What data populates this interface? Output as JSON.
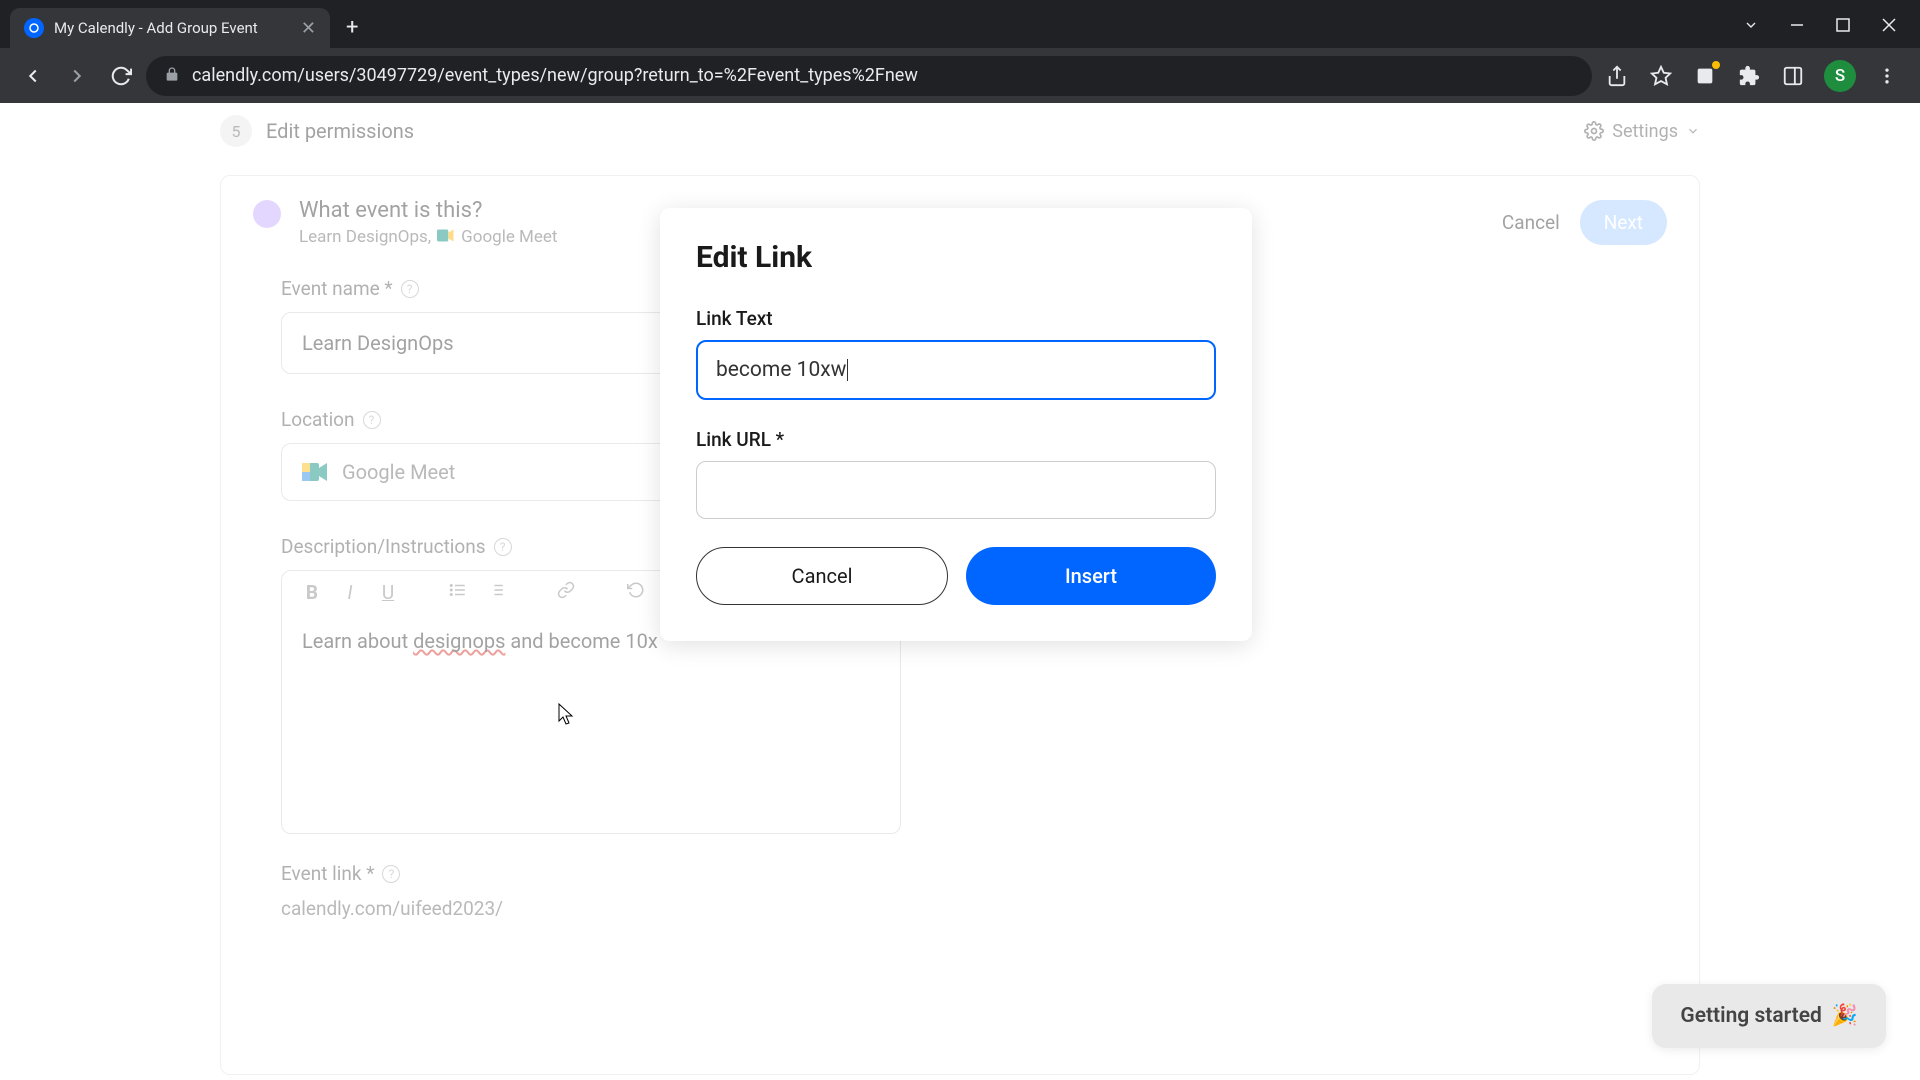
{
  "browser": {
    "tab_title": "My Calendly - Add Group Event",
    "url": "calendly.com/users/30497729/event_types/new/group?return_to=%2Fevent_types%2Fnew",
    "avatar_initial": "S"
  },
  "page_header": {
    "step_num": "5",
    "step_label": "Edit permissions",
    "settings": "Settings"
  },
  "card": {
    "heading": "What event is this?",
    "sub_pre": "Learn DesignOps,",
    "sub_post": "Google Meet",
    "cancel": "Cancel",
    "next": "Next"
  },
  "form": {
    "event_name_label": "Event name *",
    "event_name_value": "Learn DesignOps",
    "location_label": "Location",
    "location_value": "Google Meet",
    "description_label": "Description/Instructions",
    "description_pre": "Learn about ",
    "description_spell": "designops",
    "description_post": " and become 10x",
    "event_link_label": "Event link *",
    "event_link_value": "calendly.com/uifeed2023/"
  },
  "modal": {
    "title": "Edit Link",
    "link_text_label": "Link Text",
    "link_text_value": "become 10xw",
    "link_url_label": "Link URL *",
    "link_url_value": "",
    "cancel": "Cancel",
    "insert": "Insert"
  },
  "widget": {
    "label": "Getting started"
  }
}
